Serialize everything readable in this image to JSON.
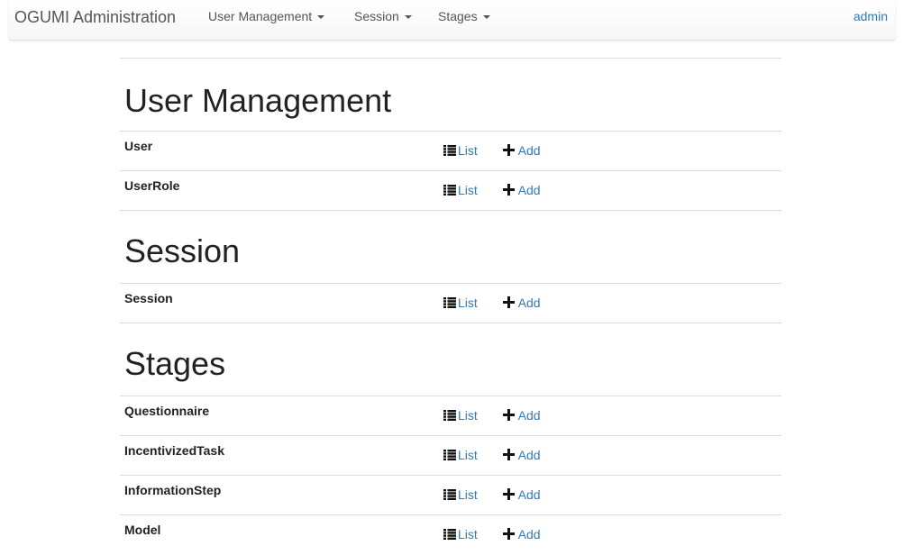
{
  "navbar": {
    "brand": "OGUMI Administration",
    "menus": [
      {
        "label": "User Management"
      },
      {
        "label": "Session"
      },
      {
        "label": "Stages"
      }
    ],
    "user": "admin"
  },
  "actions": {
    "list_label": "List",
    "add_label": "Add",
    "list_icon": "list-icon",
    "add_icon": "plus-icon"
  },
  "sections": [
    {
      "heading": "User Management",
      "models": [
        {
          "name": "User"
        },
        {
          "name": "UserRole"
        }
      ]
    },
    {
      "heading": "Session",
      "models": [
        {
          "name": "Session"
        }
      ]
    },
    {
      "heading": "Stages",
      "models": [
        {
          "name": "Questionnaire"
        },
        {
          "name": "IncentivizedTask"
        },
        {
          "name": "InformationStep"
        },
        {
          "name": "Model"
        }
      ]
    }
  ],
  "colors": {
    "link": "#337ab7",
    "text": "#333333",
    "rule": "#dddddd"
  }
}
